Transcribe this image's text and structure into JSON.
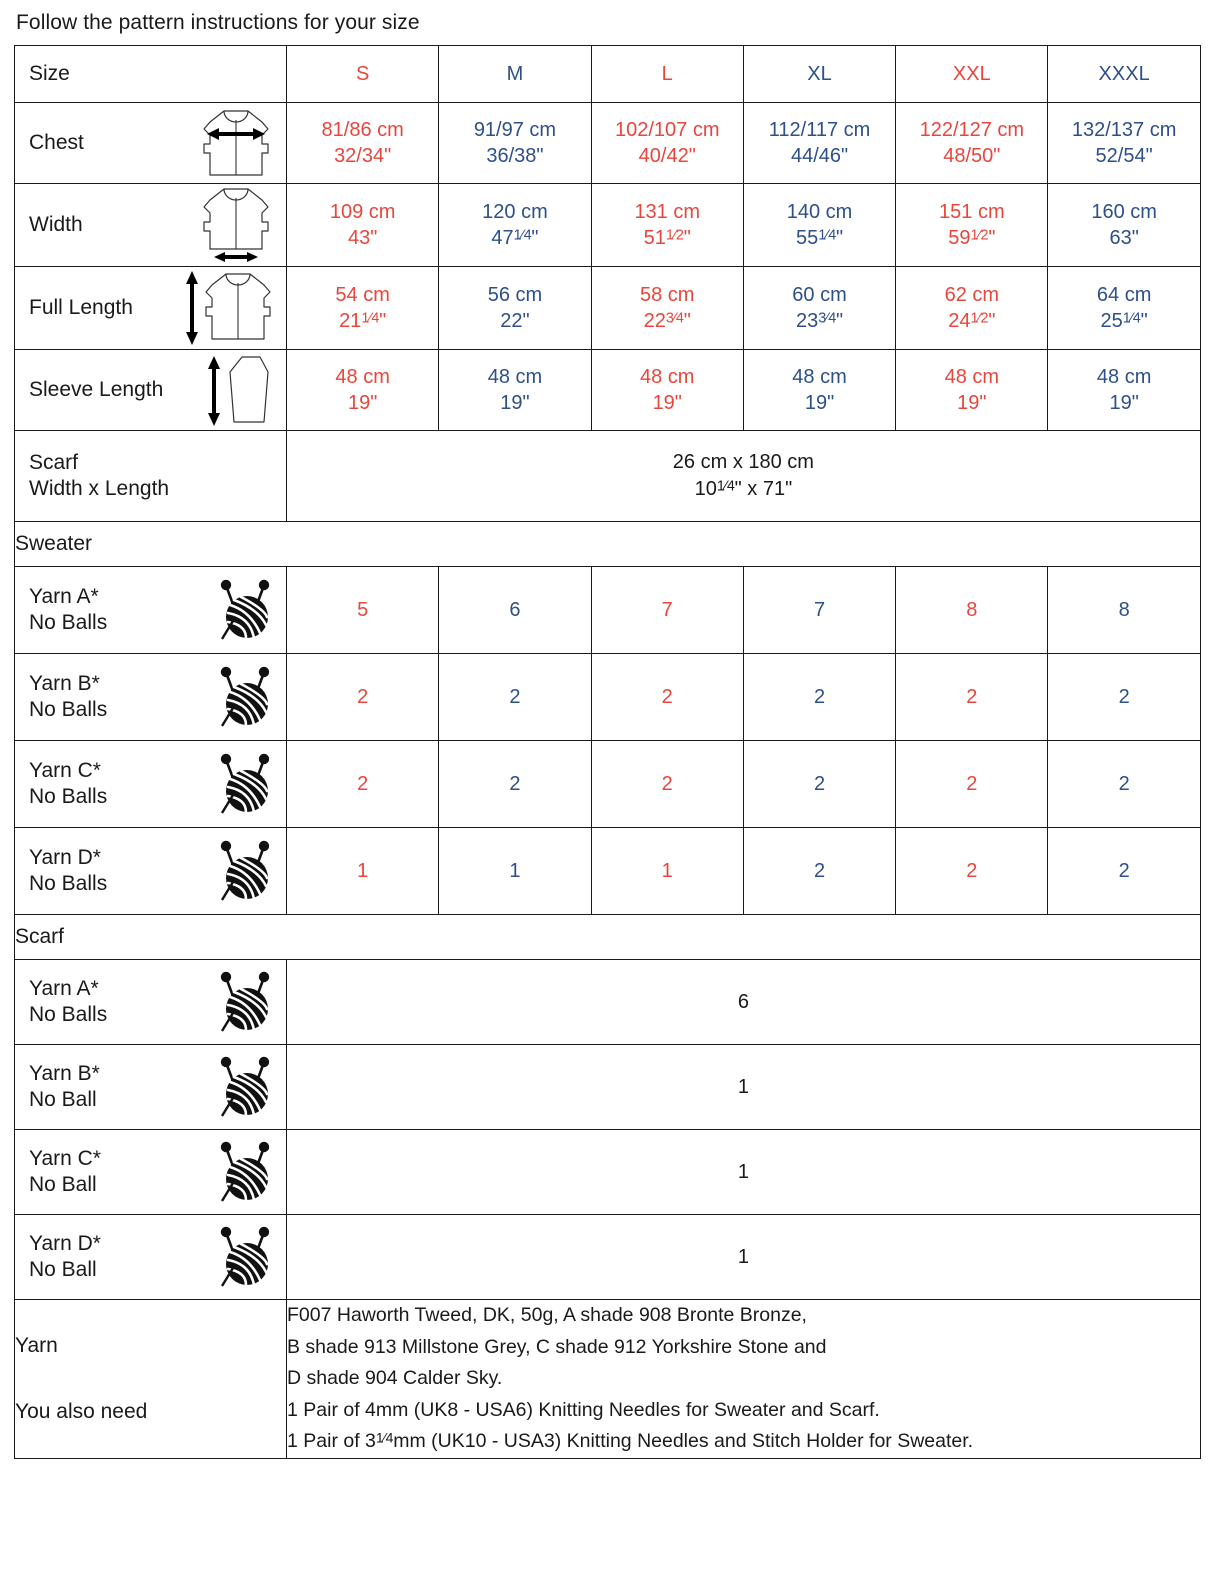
{
  "intro": "Follow the pattern instructions for your size",
  "colors": {
    "red": "#e8463c",
    "blue": "#2d4f8a",
    "black": "#1a1a1a"
  },
  "header": {
    "label": "Size",
    "sizes": [
      {
        "label": "S",
        "color": "red"
      },
      {
        "label": "M",
        "color": "blue"
      },
      {
        "label": "L",
        "color": "red"
      },
      {
        "label": "XL",
        "color": "blue"
      },
      {
        "label": "XXL",
        "color": "red"
      },
      {
        "label": "XXXL",
        "color": "blue"
      }
    ]
  },
  "measurements": [
    {
      "label": "Chest",
      "icon": "sweater-chest-width-icon",
      "values": [
        {
          "cm": "81/86 cm",
          "in": "32/34\""
        },
        {
          "cm": "91/97 cm",
          "in": "36/38\""
        },
        {
          "cm": "102/107 cm",
          "in": "40/42\""
        },
        {
          "cm": "112/117 cm",
          "in": "44/46\""
        },
        {
          "cm": "122/127 cm",
          "in": "48/50\""
        },
        {
          "cm": "132/137 cm",
          "in": "52/54\""
        }
      ]
    },
    {
      "label": "Width",
      "icon": "sweater-hem-width-icon",
      "values": [
        {
          "cm": "109 cm",
          "in": "43\""
        },
        {
          "cm": "120 cm",
          "in": "47¹⁄₄\""
        },
        {
          "cm": "131 cm",
          "in": "51½\""
        },
        {
          "cm": "140 cm",
          "in": "55¹⁄₄\""
        },
        {
          "cm": "151 cm",
          "in": "59½\""
        },
        {
          "cm": "160 cm",
          "in": "63\""
        }
      ]
    },
    {
      "label": "Full Length",
      "icon": "sweater-full-length-icon",
      "values": [
        {
          "cm": "54 cm",
          "in": "21¹⁄₄\""
        },
        {
          "cm": "56 cm",
          "in": "22\""
        },
        {
          "cm": "58 cm",
          "in": "22¾\""
        },
        {
          "cm": "60 cm",
          "in": "23¾\""
        },
        {
          "cm": "62 cm",
          "in": "24½\""
        },
        {
          "cm": "64 cm",
          "in": "25¹⁄₄\""
        }
      ]
    },
    {
      "label": "Sleeve Length",
      "icon": "sleeve-length-icon",
      "values": [
        {
          "cm": "48 cm",
          "in": "19\""
        },
        {
          "cm": "48 cm",
          "in": "19\""
        },
        {
          "cm": "48 cm",
          "in": "19\""
        },
        {
          "cm": "48 cm",
          "in": "19\""
        },
        {
          "cm": "48 cm",
          "in": "19\""
        },
        {
          "cm": "48 cm",
          "in": "19\""
        }
      ]
    }
  ],
  "scarf_dimensions": {
    "label": "Scarf\nWidth x Length",
    "cm": "26 cm x 180 cm",
    "in": "10¹⁄₄\" x 71\""
  },
  "sweater_section": {
    "title": "Sweater",
    "rows": [
      {
        "label": "Yarn A*\nNo Balls",
        "icon": "yarn-ball-icon",
        "values": [
          "5",
          "6",
          "7",
          "7",
          "8",
          "8"
        ]
      },
      {
        "label": "Yarn B*\nNo Balls",
        "icon": "yarn-ball-icon",
        "values": [
          "2",
          "2",
          "2",
          "2",
          "2",
          "2"
        ]
      },
      {
        "label": "Yarn C*\nNo Balls",
        "icon": "yarn-ball-icon",
        "values": [
          "2",
          "2",
          "2",
          "2",
          "2",
          "2"
        ]
      },
      {
        "label": "Yarn D*\nNo Balls",
        "icon": "yarn-ball-icon",
        "values": [
          "1",
          "1",
          "1",
          "2",
          "2",
          "2"
        ]
      }
    ]
  },
  "scarf_section": {
    "title": "Scarf",
    "rows": [
      {
        "label": "Yarn A*\nNo Balls",
        "icon": "yarn-ball-icon",
        "value": "6"
      },
      {
        "label": "Yarn B*\nNo Ball",
        "icon": "yarn-ball-icon",
        "value": "1"
      },
      {
        "label": "Yarn C*\nNo Ball",
        "icon": "yarn-ball-icon",
        "value": "1"
      },
      {
        "label": "Yarn D*\nNo Ball",
        "icon": "yarn-ball-icon",
        "value": "1"
      }
    ]
  },
  "notes": {
    "label_yarn": "Yarn",
    "label_also": "You also need",
    "lines": [
      "F007 Haworth Tweed, DK, 50g, A shade 908 Bronte Bronze,",
      "B shade 913 Millstone Grey, C shade 912 Yorkshire Stone and",
      "D shade 904 Calder Sky.",
      "1 Pair of 4mm (UK8 - USA6) Knitting Needles for Sweater and Scarf.",
      "1 Pair of 3¹⁄₄mm (UK10 - USA3) Knitting Needles and Stitch Holder for Sweater."
    ]
  }
}
